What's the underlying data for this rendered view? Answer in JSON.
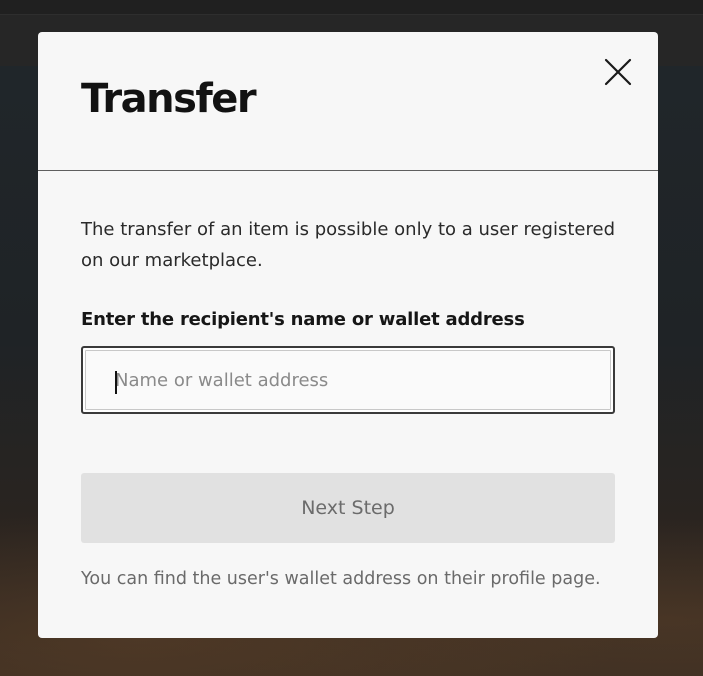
{
  "modal": {
    "title": "Transfer",
    "description": "The transfer of an item is possible only to a user registered on our marketplace.",
    "field_label": "Enter the recipient's name or wallet address",
    "input": {
      "value": "",
      "placeholder": "Name or wallet address"
    },
    "next_button": {
      "label": "Next Step",
      "state": "disabled"
    },
    "hint": "You can find the user's wallet address on their profile page.",
    "close_icon": "close-icon"
  },
  "colors": {
    "modal_background": "#f7f7f7",
    "backdrop": "#1c1c1c",
    "button_disabled_bg": "#e1e1e1",
    "button_disabled_text": "#6b6b6b",
    "title_text": "#121212"
  }
}
